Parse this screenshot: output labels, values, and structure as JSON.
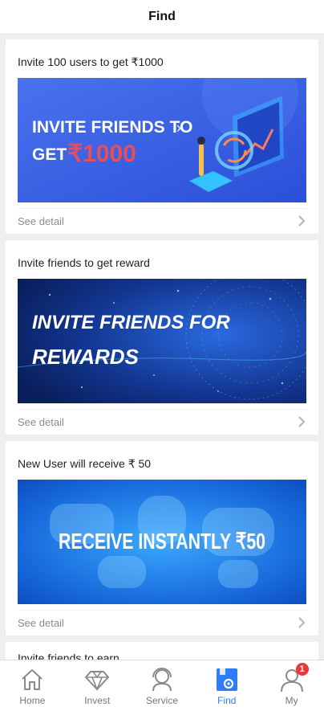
{
  "header": {
    "title": "Find"
  },
  "cards": [
    {
      "title": "Invite 100 users to get ₹1000",
      "banner_line1": "INVITE FRIENDS TO",
      "banner_line2_a": "GET",
      "banner_line2_b": "₹1000",
      "see_detail": "See detail"
    },
    {
      "title": "Invite friends to get reward",
      "banner_line1": "INVITE FRIENDS FOR",
      "banner_line2": "REWARDS",
      "see_detail": "See detail"
    },
    {
      "title": "New User will receive ₹ 50",
      "banner_text": "RECEIVE INSTANTLY ₹50",
      "see_detail": "See detail"
    },
    {
      "title": "Invite friends to earn"
    }
  ],
  "tabbar": {
    "items": [
      {
        "label": "Home",
        "icon": "home-icon"
      },
      {
        "label": "Invest",
        "icon": "diamond-icon"
      },
      {
        "label": "Service",
        "icon": "headset-icon"
      },
      {
        "label": "Find",
        "icon": "find-icon",
        "active": true
      },
      {
        "label": "My",
        "icon": "user-icon",
        "badge": "1"
      }
    ]
  },
  "colors": {
    "accent": "#2e7cf6",
    "badge": "#e8383d",
    "banner1_bg": "#3a63e8",
    "banner2_bg": "#0d2a7a",
    "banner3_bg": "#1a6fe0"
  }
}
